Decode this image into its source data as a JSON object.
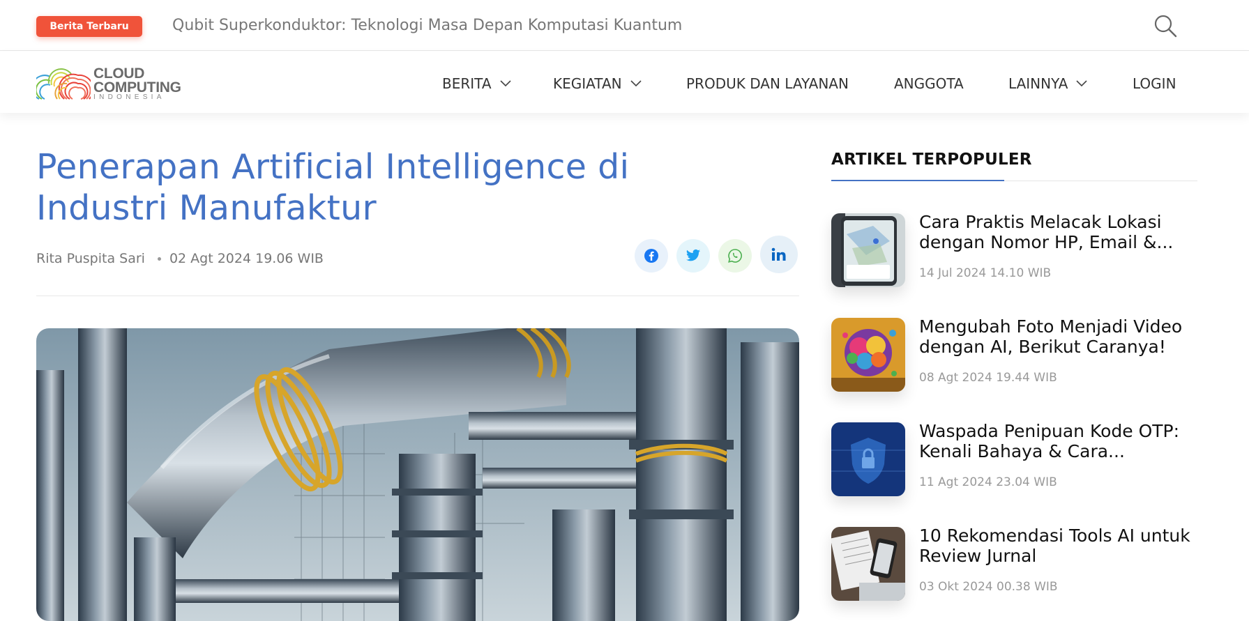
{
  "topbar": {
    "badge": "Berita Terbaru",
    "ticker": "Qubit Superkonduktor: Teknologi Masa Depan Komputasi Kuantum"
  },
  "logo": {
    "line1": "CLOUD",
    "line2": "COMPUTING",
    "line3": "INDONESIA"
  },
  "nav": {
    "items": [
      {
        "label": "BERITA",
        "has_dropdown": true
      },
      {
        "label": "KEGIATAN",
        "has_dropdown": true
      },
      {
        "label": "PRODUK DAN LAYANAN",
        "has_dropdown": false
      },
      {
        "label": "ANGGOTA",
        "has_dropdown": false
      },
      {
        "label": "LAINNYA",
        "has_dropdown": true
      },
      {
        "label": "LOGIN",
        "has_dropdown": false
      }
    ]
  },
  "article": {
    "title": "Penerapan Artificial Intelligence di Industri Manufaktur",
    "author": "Rita Puspita Sari",
    "date": "02 Agt 2024 19.06 WIB",
    "share": [
      "facebook-icon",
      "twitter-icon",
      "whatsapp-icon",
      "linkedin-icon"
    ]
  },
  "sidebar": {
    "title": "ARTIKEL TERPOPULER",
    "items": [
      {
        "title": "Cara Praktis Melacak Lokasi dengan Nomor HP, Email &...",
        "date": "14 Jul 2024 14.10 WIB"
      },
      {
        "title": "Mengubah Foto Menjadi Video dengan AI, Berikut Caranya!",
        "date": "08 Agt 2024 19.44 WIB"
      },
      {
        "title": "Waspada Penipuan Kode OTP: Kenali Bahaya & Cara...",
        "date": "11 Agt 2024 23.04 WIB"
      },
      {
        "title": "10 Rekomendasi Tools AI untuk Review Jurnal",
        "date": "03 Okt 2024 00.38 WIB"
      }
    ]
  },
  "colors": {
    "accent": "#4472c4",
    "badge": "#f0533a"
  }
}
